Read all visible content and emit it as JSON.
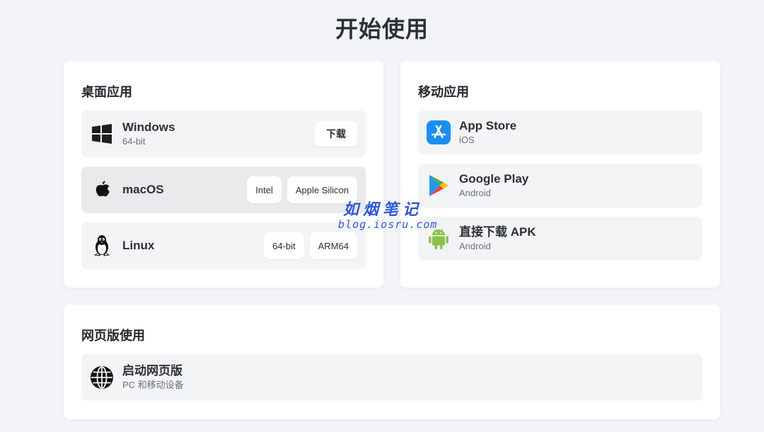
{
  "page_title": "开始使用",
  "desktop": {
    "title": "桌面应用",
    "items": [
      {
        "icon": "windows-icon",
        "name": "Windows",
        "sub": "64-bit",
        "buttons": [
          "下载"
        ]
      },
      {
        "icon": "apple-icon",
        "name": "macOS",
        "sub": "",
        "buttons": [
          "Intel",
          "Apple Silicon"
        ]
      },
      {
        "icon": "linux-icon",
        "name": "Linux",
        "sub": "",
        "buttons": [
          "64-bit",
          "ARM64"
        ]
      }
    ]
  },
  "mobile": {
    "title": "移动应用",
    "items": [
      {
        "icon": "app-store-icon",
        "name": "App Store",
        "sub": "iOS"
      },
      {
        "icon": "google-play-icon",
        "name": "Google Play",
        "sub": "Android"
      },
      {
        "icon": "android-icon",
        "name": "直接下载 APK",
        "sub": "Android"
      }
    ]
  },
  "web": {
    "title": "网页版使用",
    "items": [
      {
        "icon": "globe-icon",
        "name": "启动网页版",
        "sub": "PC 和移动设备"
      }
    ]
  },
  "watermark": {
    "cn": "如烟笔记",
    "en": "blog.iosru.com"
  },
  "colors": {
    "background": "#f2f4f7",
    "card": "#ffffff",
    "row": "#f3f4f6",
    "watermark": "#2f57d6",
    "app_store_blue": "#1b8ef5",
    "android_green": "#8bc34a"
  }
}
